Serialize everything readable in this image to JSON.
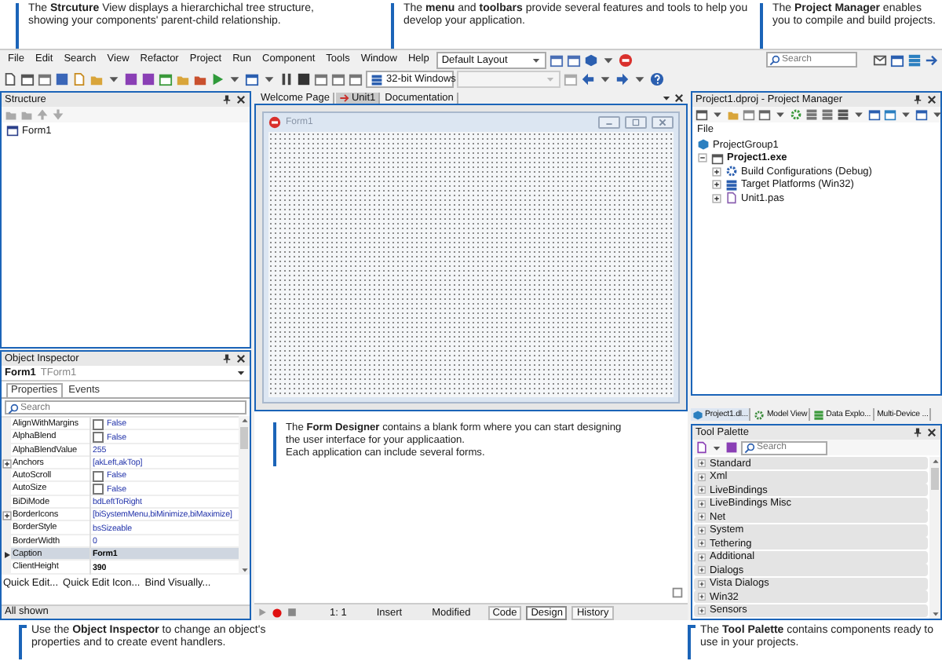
{
  "top_callouts": [
    {
      "paragraphs": [
        "The **Strcuture** View displays a hierarchichal tree structure, showing your components' parent-child relationship."
      ]
    },
    {
      "paragraphs": [
        "The **menu** and **toolbars** provide several features and tools to help you develop your application."
      ]
    },
    {
      "paragraphs": [
        "The **Project Manager** enables you to compile and build projects."
      ]
    }
  ],
  "menu": [
    "File",
    "Edit",
    "Search",
    "View",
    "Refactor",
    "Project",
    "Run",
    "Component",
    "Tools",
    "Window",
    "Help"
  ],
  "layout_dropdown": {
    "value": "Default Layout"
  },
  "platform_dropdown": {
    "value": "32-bit Windows"
  },
  "ide_search": {
    "placeholder": "Search"
  },
  "structure": {
    "title": "Structure",
    "tree": [
      {
        "label": "Form1"
      }
    ]
  },
  "object_inspector": {
    "title": "Object Inspector",
    "object_name": "Form1",
    "object_type": "TForm1",
    "tabs": [
      {
        "label": "Properties",
        "selected": true
      },
      {
        "label": "Events",
        "selected": false
      }
    ],
    "search": {
      "placeholder": "Search"
    },
    "properties": [
      {
        "name": "AlignWithMargins",
        "kind": "checkbox",
        "value": "False",
        "checked": false,
        "changed": false,
        "selected": false
      },
      {
        "name": "AlphaBlend",
        "kind": "checkbox",
        "value": "False",
        "checked": false,
        "changed": false,
        "selected": false
      },
      {
        "name": "AlphaBlendValue",
        "kind": "text",
        "value": "255",
        "changed": false,
        "selected": false
      },
      {
        "name": "Anchors",
        "kind": "text",
        "value": "[akLeft,akTop]",
        "changed": false,
        "selected": false,
        "expanded": false
      },
      {
        "name": "AutoScroll",
        "kind": "checkbox",
        "value": "False",
        "checked": false,
        "changed": false,
        "selected": false
      },
      {
        "name": "AutoSize",
        "kind": "checkbox",
        "value": "False",
        "checked": false,
        "changed": false,
        "selected": false
      },
      {
        "name": "BiDiMode",
        "kind": "text",
        "value": "bdLeftToRight",
        "changed": false,
        "selected": false
      },
      {
        "name": "BorderIcons",
        "kind": "text",
        "value": "[biSystemMenu,biMinimize,biMaximize]",
        "changed": false,
        "selected": false,
        "expanded": false
      },
      {
        "name": "BorderStyle",
        "kind": "text",
        "value": "bsSizeable",
        "changed": false,
        "selected": false
      },
      {
        "name": "BorderWidth",
        "kind": "text",
        "value": "0",
        "changed": false,
        "selected": false
      },
      {
        "name": "Caption",
        "kind": "text",
        "value": "Form1",
        "changed": true,
        "selected": true
      },
      {
        "name": "ClientHeight",
        "kind": "text",
        "value": "390",
        "changed": true,
        "selected": false
      }
    ],
    "links": [
      "Quick Edit...",
      "Quick Edit Icon...",
      "Bind Visually..."
    ],
    "status": "All shown"
  },
  "editor": {
    "tabs": [
      {
        "label": "Welcome Page",
        "selected": false
      },
      {
        "label": "Unit1",
        "selected": true
      },
      {
        "label": "Documentation",
        "selected": false
      }
    ],
    "form_title": "Form1",
    "status": {
      "position": "1:  1",
      "mode": "Insert",
      "state": "Modified"
    },
    "view_tabs": [
      {
        "label": "Code",
        "selected": false
      },
      {
        "label": "Design",
        "selected": true
      },
      {
        "label": "History",
        "selected": false
      }
    ]
  },
  "designer_callout": {
    "paragraphs": [
      "The **Form Designer** contains a blank form where you can start designing the user interface for your applicaation.",
      "Each application can include several forms."
    ]
  },
  "project_manager": {
    "title": "Project1.dproj - Project Manager",
    "header": "File",
    "tree": [
      {
        "label": "ProjectGroup1",
        "bold": false
      },
      {
        "label": "Project1.exe",
        "bold": true,
        "expanded": true,
        "children": [
          {
            "label": "Build Configurations (Debug)",
            "bold": false,
            "expanded": false
          },
          {
            "label": "Target Platforms (Win32)",
            "bold": false,
            "expanded": false
          },
          {
            "label": "Unit1.pas",
            "bold": false,
            "expanded": false
          }
        ]
      }
    ]
  },
  "dock_tabs": [
    {
      "label": "Project1.dl...",
      "selected": true
    },
    {
      "label": "Model View",
      "selected": false
    },
    {
      "label": "Data Explo...",
      "selected": false
    },
    {
      "label": "Multi-Device ...",
      "selected": false
    }
  ],
  "tool_palette": {
    "title": "Tool Palette",
    "search": {
      "placeholder": "Search"
    },
    "categories": [
      "Standard",
      "Xml",
      "LiveBindings",
      "LiveBindings Misc",
      "Net",
      "System",
      "Tethering",
      "Additional",
      "Dialogs",
      "Vista Dialogs",
      "Win32",
      "Sensors"
    ]
  },
  "bottom_callouts": [
    {
      "paragraphs": [
        "Use the **Object Inspector** to change an object's properties and to create event handlers."
      ]
    },
    {
      "paragraphs": [
        "The **Tool Palette** contains components ready to use in your projects."
      ]
    }
  ]
}
